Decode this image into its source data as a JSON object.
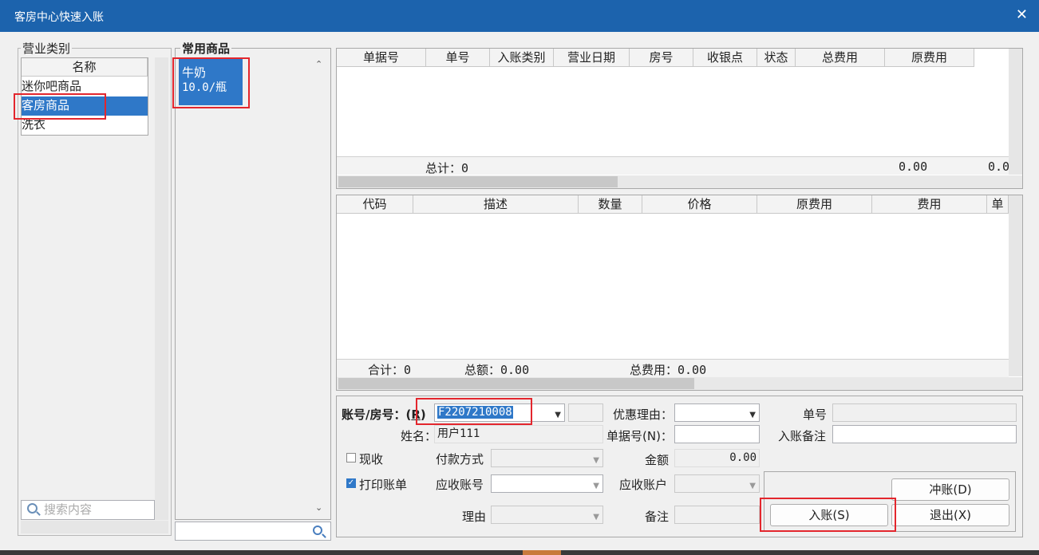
{
  "window": {
    "title": "客房中心快速入账",
    "close_glyph": "✕"
  },
  "category_panel": {
    "legend": "营业类别",
    "column_header": "名称",
    "items": [
      "迷你吧商品",
      "客房商品",
      "洗衣"
    ],
    "selected_index": 1,
    "search_placeholder": "搜索内容"
  },
  "common_goods": {
    "legend": "常用商品",
    "items": [
      {
        "name": "牛奶",
        "price": "10.0/瓶"
      }
    ]
  },
  "bills_table": {
    "columns": [
      "单据号",
      "单号",
      "入账类别",
      "营业日期",
      "房号",
      "收银点",
      "状态",
      "总费用",
      "原费用"
    ],
    "footer_label": "总计：0",
    "footer_total": "0.00",
    "footer_original": "0.00"
  },
  "items_table": {
    "columns": [
      "代码",
      "描述",
      "数量",
      "价格",
      "原费用",
      "费用",
      "单"
    ],
    "footer_count": "合计：0",
    "footer_amount": "总额：0.00",
    "footer_total": "总费用：0.00"
  },
  "form": {
    "account_label": "账号/房号：(",
    "account_key": "R",
    "account_value": "F2207210008",
    "name_label": "姓名：",
    "name_value": "用户111",
    "cash_label": "现收",
    "print_label": "打印账单",
    "payment_label": "付款方式",
    "receivable_no_label": "应收账号",
    "reason_label": "理由",
    "discount_label": "优惠理由：",
    "bill_no_label": "单据号(N)：",
    "amount_label": "金额",
    "amount_value": "0.00",
    "receivable_acct_label": "应收账户",
    "remark_label": "备注",
    "order_no_label": "单号",
    "entry_remark_label": "入账备注"
  },
  "buttons": {
    "reverse": "冲账(D)",
    "post": "入账(S)",
    "exit": "退出(X)"
  },
  "colors": {
    "titlebar": "#1c63ad",
    "selection": "#2f78c8",
    "highlight": "#e3262d"
  }
}
